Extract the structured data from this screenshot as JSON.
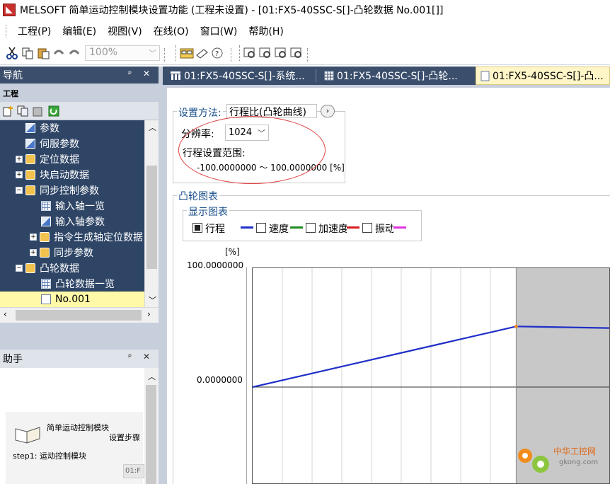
{
  "window": {
    "title": "MELSOFT 简单运动控制模块设置功能 (工程未设置) - [01:FX5-40SSC-S[]-凸轮数据 No.001[]]"
  },
  "menu": [
    "工程(P)",
    "编辑(E)",
    "视图(V)",
    "在线(O)",
    "窗口(W)",
    "帮助(H)"
  ],
  "toolbar": {
    "zoom": "100%"
  },
  "nav": {
    "title": "导航",
    "controls": "ᵖ ✕",
    "section": "工程",
    "items": [
      {
        "label": "参数",
        "icon": "param-icon",
        "expander": ""
      },
      {
        "label": "伺服参数",
        "icon": "param-icon",
        "expander": ""
      },
      {
        "label": "定位数据",
        "icon": "folder-icon",
        "expander": "+"
      },
      {
        "label": "块启动数据",
        "icon": "folder-icon",
        "expander": "+"
      },
      {
        "label": "同步控制参数",
        "icon": "folder-icon",
        "expander": "−"
      },
      {
        "label": "输入轴一览",
        "icon": "grid-icon",
        "expander": ""
      },
      {
        "label": "输入轴参数",
        "icon": "param-icon",
        "expander": ""
      },
      {
        "label": "指令生成轴定位数据",
        "icon": "folder-icon",
        "expander": "+"
      },
      {
        "label": "同步参数",
        "icon": "folder-icon",
        "expander": "+"
      },
      {
        "label": "凸轮数据",
        "icon": "folder-icon",
        "expander": "−"
      },
      {
        "label": "凸轮数据一览",
        "icon": "grid-icon",
        "expander": ""
      },
      {
        "label": "No.001",
        "icon": "page-icon",
        "expander": ""
      }
    ]
  },
  "helper": {
    "title": "助手",
    "controls": "ᵖ ✕",
    "card_title": "简单运动控制模块",
    "card_sub": "设置步骤",
    "step": "step1: 运动控制模块",
    "badge": "01:F"
  },
  "tabs": [
    {
      "label": "01:FX5-40SSC-S[]-系统..."
    },
    {
      "label": "01:FX5-40SSC-S[]-凸轮..."
    },
    {
      "label": "01:FX5-40SSC-S[]-凸..."
    }
  ],
  "settings": {
    "method_label": "设置方法:",
    "method_value": "行程比(凸轮曲线)",
    "method_button": "›",
    "resolution_label": "分辨率:",
    "resolution_value": "1024",
    "range_label": "行程设置范围:",
    "range_value": "-100.0000000 ～  100.0000000 [%]"
  },
  "cam_chart": {
    "group_label": "凸轮图表",
    "display_label": "显示图表",
    "legend": [
      {
        "label": "行程",
        "checked": true,
        "color": "#1f2fc8"
      },
      {
        "label": "速度",
        "checked": false,
        "color": "#1e8a1e"
      },
      {
        "label": "加速度",
        "checked": false,
        "color": "#d81c1c"
      },
      {
        "label": "振动",
        "checked": false,
        "color": "#e033e0"
      }
    ],
    "y_unit": "[%]",
    "y_top_label": "100.0000000",
    "y_zero_label": "0.0000000"
  },
  "chart_data": {
    "type": "line",
    "title": "",
    "ylabel": "[%]",
    "ylim": [
      -100,
      100
    ],
    "series": [
      {
        "name": "行程",
        "x": [
          0,
          0.49,
          1.0
        ],
        "values": [
          0,
          51,
          47
        ]
      }
    ],
    "shaded_region_start_x": 0.49,
    "grid": true
  },
  "watermark": {
    "brand": "中华工控网",
    "domain": "gkong.com"
  }
}
